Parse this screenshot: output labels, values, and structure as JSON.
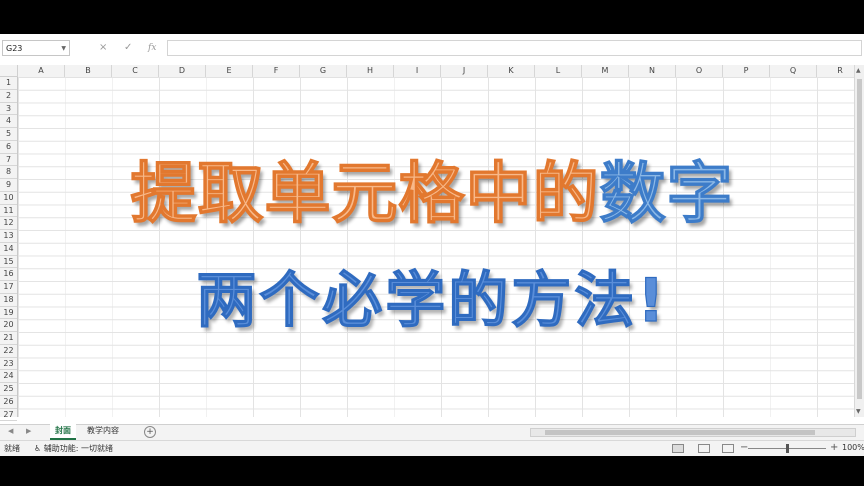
{
  "formula_bar": {
    "name_box": "G23",
    "cancel_icon": "×",
    "enter_icon": "✓",
    "fx_label": "fx"
  },
  "columns": [
    "A",
    "B",
    "C",
    "D",
    "E",
    "F",
    "G",
    "H",
    "I",
    "J",
    "K",
    "L",
    "M",
    "N",
    "O",
    "P",
    "Q",
    "R"
  ],
  "rows": [
    "1",
    "2",
    "3",
    "4",
    "5",
    "6",
    "7",
    "8",
    "9",
    "10",
    "11",
    "12",
    "13",
    "14",
    "15",
    "16",
    "17",
    "18",
    "19",
    "20",
    "21",
    "22",
    "23",
    "24",
    "25",
    "26",
    "27"
  ],
  "headline": {
    "line1_orange": "提取单元格中的",
    "line1_blue": "数字",
    "line2": "两个必学的方法!"
  },
  "sheet_tabs": [
    "封面",
    "教学内容"
  ],
  "status_bar": {
    "ready": "就绪",
    "accessibility": "辅助功能: 一切就绪",
    "zoom": "100%"
  },
  "colors": {
    "orange_fill": "#f8b98a",
    "orange_stroke": "#e2782f",
    "blue_fill": "#5a8ed9",
    "excel_green": "#217346"
  }
}
